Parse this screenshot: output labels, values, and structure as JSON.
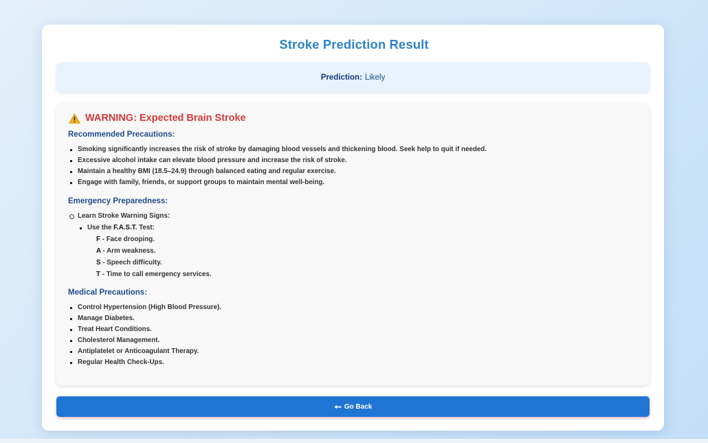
{
  "page": {
    "title": "Stroke Prediction Result"
  },
  "prediction": {
    "label": "Prediction:",
    "value": "Likely"
  },
  "warning": {
    "icon": "warning-triangle-icon",
    "text": "WARNING: Expected Brain Stroke"
  },
  "recommended": {
    "heading": "Recommended Precautions:",
    "items": [
      "Smoking significantly increases the risk of stroke by damaging blood vessels and thickening blood. Seek help to quit if needed.",
      "Excessive alcohol intake can elevate blood pressure and increase the risk of stroke.",
      "Maintain a healthy BMI (18.5–24.9) through balanced eating and regular exercise.",
      "Engage with family, friends, or support groups to maintain mental well-being."
    ]
  },
  "emergency": {
    "heading": "Emergency Preparedness:",
    "item": "Learn Stroke Warning Signs:",
    "fast_prefix": "Use the",
    "fast_name": "F.A.S.T.",
    "fast_suffix": "Test:",
    "fast": [
      {
        "letter": "F",
        "text": "- Face drooping."
      },
      {
        "letter": "A",
        "text": "- Arm weakness."
      },
      {
        "letter": "S",
        "text": "- Speech difficulty."
      },
      {
        "letter": "T",
        "text": "- Time to call emergency services."
      }
    ]
  },
  "medical": {
    "heading": "Medical Precautions:",
    "items": [
      "Control Hypertension (High Blood Pressure).",
      "Manage Diabetes.",
      "Treat Heart Conditions.",
      "Cholesterol Management.",
      "Antiplatelet or Anticoagulant Therapy.",
      "Regular Health Check-Ups."
    ]
  },
  "back_button": {
    "icon": "left-arrow-icon",
    "label": "Go Back"
  },
  "colors": {
    "title": "#2d83c8",
    "warning": "#d23a3a",
    "heading": "#1f4d8c",
    "button": "#1f75d4"
  }
}
